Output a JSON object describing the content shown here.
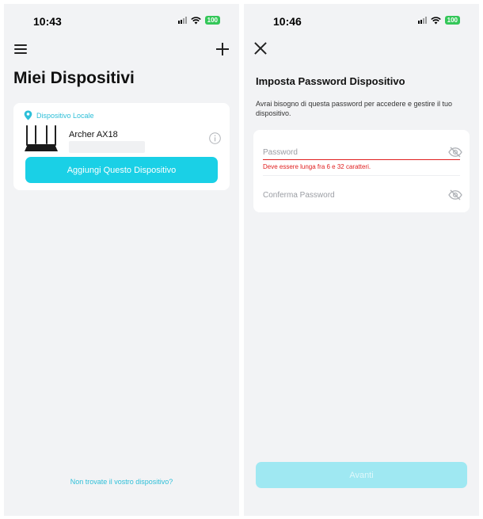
{
  "left_screen": {
    "status": {
      "time": "10:43",
      "battery": "100"
    },
    "title": "Miei Dispositivi",
    "device_card": {
      "section_label": "Dispositivo Locale",
      "device_name": "Archer AX18",
      "add_button": "Aggiungi Questo Dispositivo"
    },
    "footer_link": "Non trovate il vostro dispositivo?"
  },
  "right_screen": {
    "status": {
      "time": "10:46",
      "battery": "100"
    },
    "title": "Imposta Password Dispositivo",
    "description": "Avrai bisogno di questa password per accedere e gestire il tuo dispositivo.",
    "password_field": {
      "placeholder": "Password",
      "error": "Deve essere lunga fra 6 e 32 caratteri."
    },
    "confirm_field": {
      "placeholder": "Conferma Password"
    },
    "next_button": "Avanti"
  },
  "colors": {
    "accent": "#1ad0e6",
    "accent_disabled": "#9fe8f2",
    "error": "#e02020",
    "battery": "#34c759",
    "background": "#f2f3f5"
  },
  "icons": [
    "menu-icon",
    "plus-icon",
    "location-pin-icon",
    "router-icon",
    "info-icon",
    "close-icon",
    "eye-off-icon",
    "wifi-icon",
    "signal-icon",
    "battery-icon"
  ]
}
